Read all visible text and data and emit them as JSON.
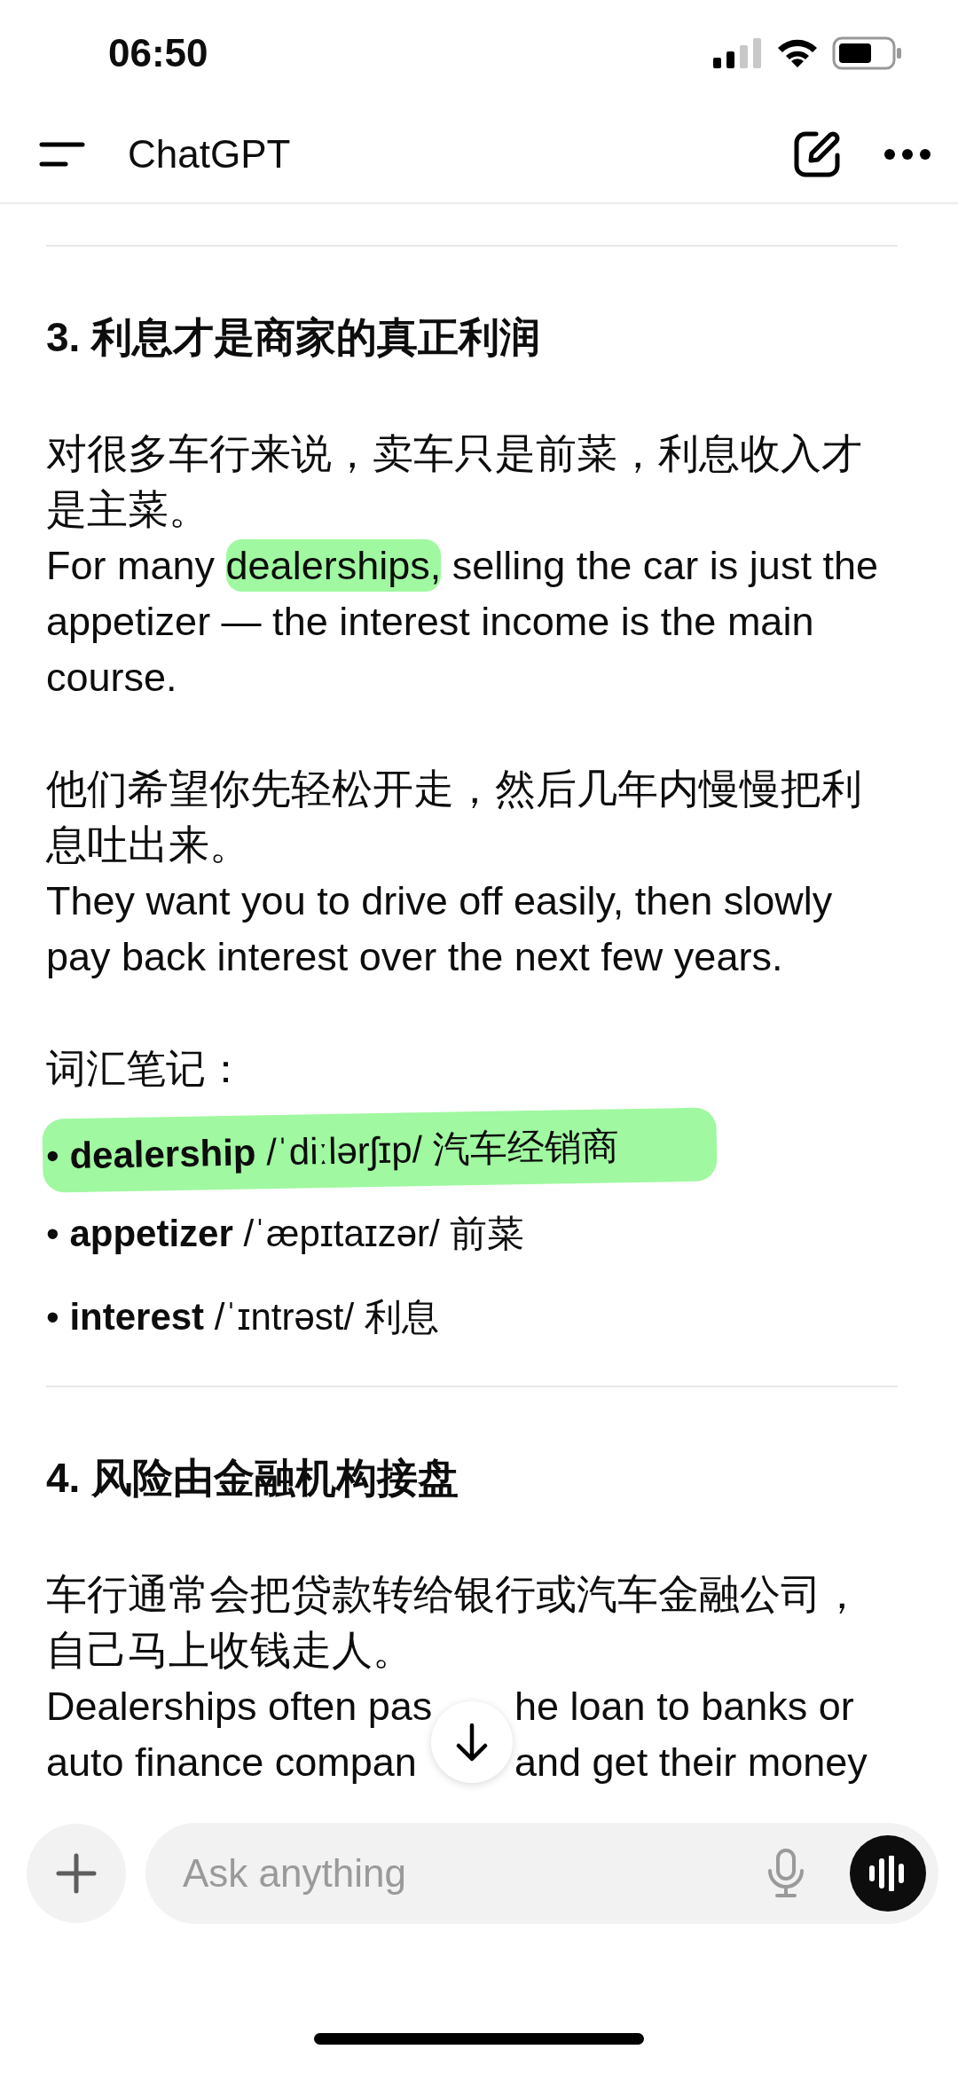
{
  "status_bar": {
    "time": "06:50"
  },
  "header": {
    "title": "ChatGPT"
  },
  "sections": [
    {
      "heading": "3. 利息才是商家的真正利润",
      "blocks": [
        {
          "kind": "paragraph",
          "zh": "对很多车行来说，卖车只是前菜，利息收入才是主菜。",
          "en": [
            {
              "text": "For many ",
              "highlighted": false
            },
            {
              "text": "dealerships,",
              "highlighted": true
            },
            {
              "text": " selling the car is just the appetizer — the interest income is the main course.",
              "highlighted": false
            }
          ]
        },
        {
          "kind": "paragraph",
          "zh": "他们希望你先轻松开走，然后几年内慢慢把利息吐出来。",
          "en": [
            {
              "text": "They want you to drive off easily, then slowly pay back interest over the next few years.",
              "highlighted": false
            }
          ]
        },
        {
          "kind": "vocab",
          "title": "词汇笔记：",
          "items": [
            {
              "bullet": "•",
              "word": "dealership",
              "ipa": "/ˈdiːlərʃɪp/",
              "meaning": "汽车经销商",
              "highlighted": true
            },
            {
              "bullet": "•",
              "word": "appetizer",
              "ipa": "/ˈæpɪtaɪzər/",
              "meaning": "前菜",
              "highlighted": false
            },
            {
              "bullet": "•",
              "word": "interest",
              "ipa": "/ˈɪntrəst/",
              "meaning": "利息",
              "highlighted": false
            }
          ]
        }
      ]
    },
    {
      "heading": "4. 风险由金融机构接盘",
      "blocks": [
        {
          "kind": "split_paragraph",
          "zh": "车行通常会把贷款转给银行或汽车金融公司，自己马上收钱走人。",
          "en_lines": [
            {
              "left": "Dealerships often pas",
              "right": "he loan to banks or"
            },
            {
              "left": "auto finance compan",
              "right": "and get their money"
            }
          ]
        }
      ]
    }
  ],
  "composer": {
    "placeholder": "Ask anything"
  }
}
